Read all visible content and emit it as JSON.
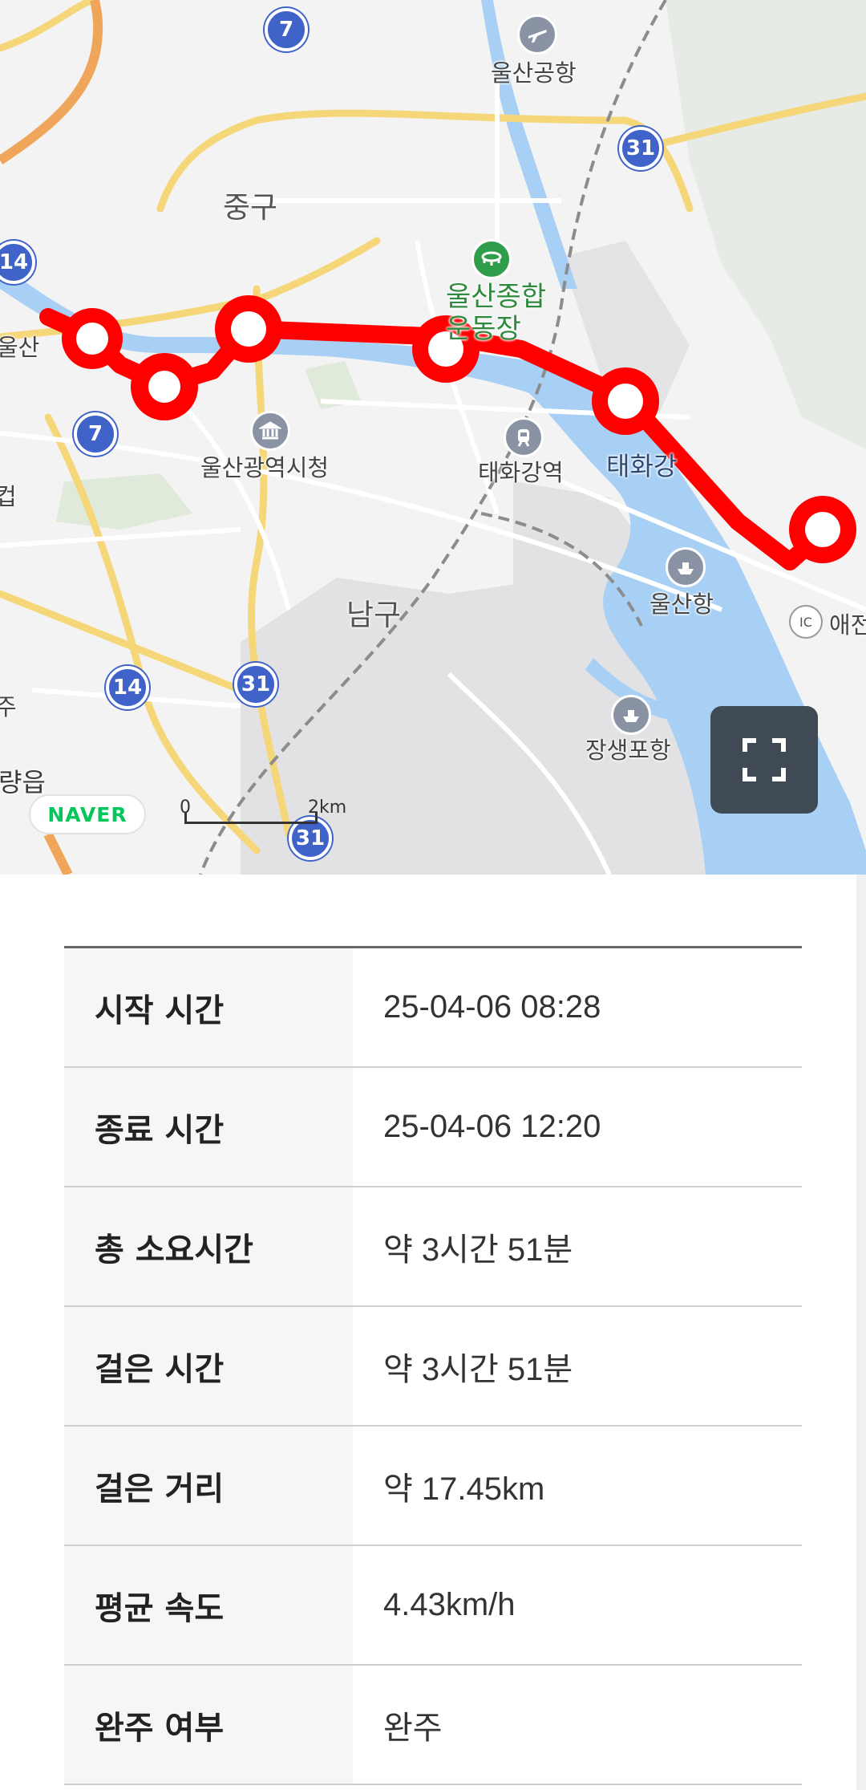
{
  "map": {
    "places": {
      "airport": "울산공항",
      "junggu": "중구",
      "stadium_line1": "울산종합",
      "stadium_line2": "운동장",
      "ulsan_left": "울산",
      "city_hall": "울산광역시청",
      "taehwa_station": "태화강역",
      "taehwagang": "태화강",
      "namgu": "남구",
      "ulsan_port": "울산항",
      "ic_label": "애전",
      "jangsaengpo": "장생포항",
      "left_edge_1": "컵",
      "left_edge_2": "주",
      "yangeup": "량읍"
    },
    "route_shields": {
      "r7_top": "7",
      "r31_top": "31",
      "r14_left": "14",
      "r7_mid": "7",
      "r14_bottom": "14",
      "r31_mid": "31",
      "r31_bottom": "31"
    },
    "ic_badge": "IC",
    "naver_logo": "NAVER",
    "scale": {
      "start": "0",
      "end": "2km"
    },
    "route_color": "#ff0000",
    "icons": [
      "airport-icon",
      "stadium-icon",
      "city-hall-icon",
      "train-station-icon",
      "port-icon",
      "harbor-icon",
      "fullscreen-icon"
    ]
  },
  "info_table": {
    "rows": [
      {
        "label": "시작 시간",
        "value": "25-04-06 08:28"
      },
      {
        "label": "종료 시간",
        "value": "25-04-06 12:20"
      },
      {
        "label": "총 소요시간",
        "value": "약 3시간 51분"
      },
      {
        "label": "걸은 시간",
        "value": "약 3시간 51분"
      },
      {
        "label": "걸은 거리",
        "value": "약 17.45km"
      },
      {
        "label": "평균 속도",
        "value": "4.43km/h"
      },
      {
        "label": "완주 여부",
        "value": "완주"
      }
    ]
  }
}
